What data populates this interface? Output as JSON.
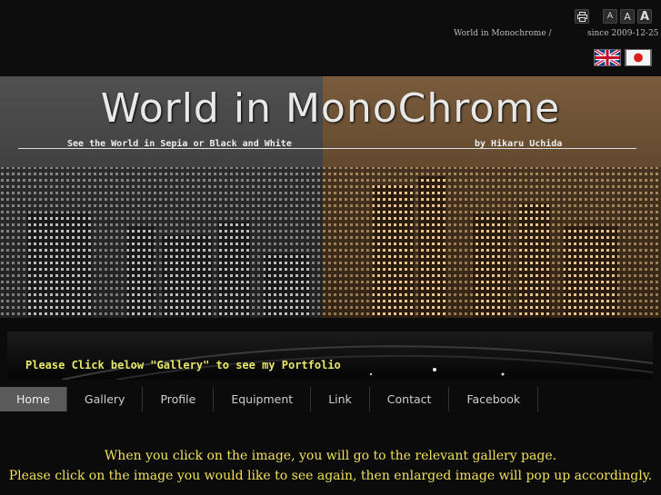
{
  "header": {
    "breadcrumb": "World in Monochrome  /",
    "since": "since 2009-12-25",
    "text_size_small": "A",
    "text_size_medium": "A",
    "text_size_large": "A",
    "print_icon": "print-icon",
    "flags": [
      "uk-flag-icon",
      "japan-flag-icon"
    ]
  },
  "banner": {
    "title": "World in MonoChrome",
    "subtitle": "See the World in Sepia or Black and White",
    "byline": "by Hikaru Uchida"
  },
  "notice": {
    "text": "Please Click below \"Gallery\" to see my Portfolio"
  },
  "nav": {
    "items": [
      {
        "label": "Home"
      },
      {
        "label": "Gallery"
      },
      {
        "label": "Profile"
      },
      {
        "label": "Equipment"
      },
      {
        "label": "Link"
      },
      {
        "label": "Contact"
      },
      {
        "label": "Facebook"
      }
    ],
    "active": "Home"
  },
  "content": {
    "line1": "When you click on the image, you will go to the relevant gallery page.",
    "line2": "Please click on the image you would like to see again, then enlarged image will pop up accordingly."
  },
  "colors": {
    "accent": "#f0e05a",
    "sepia": "#6b5034",
    "active_nav": "#5a5a5a"
  }
}
